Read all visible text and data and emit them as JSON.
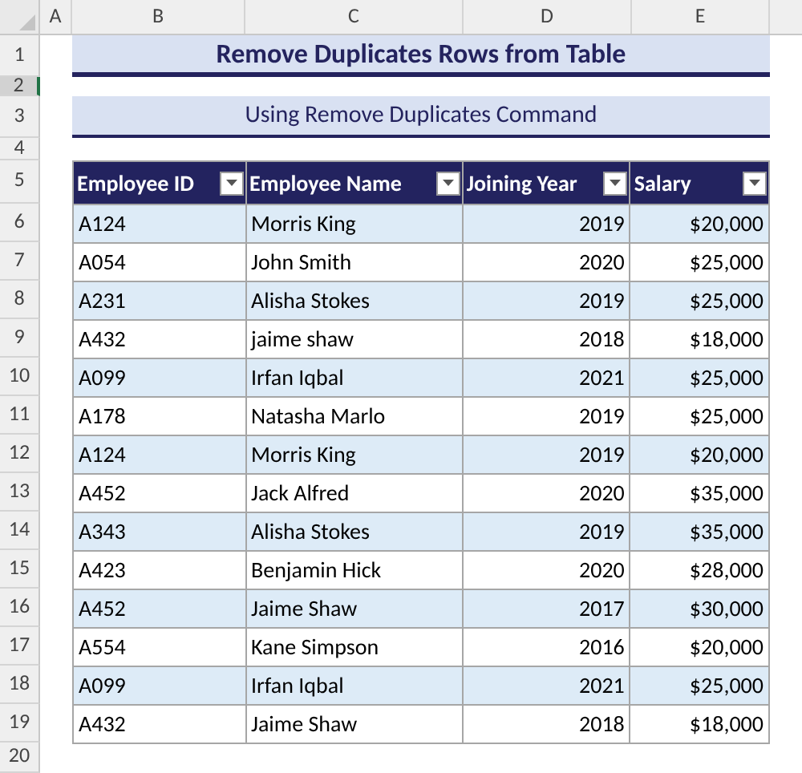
{
  "column_letters": [
    "A",
    "B",
    "C",
    "D",
    "E"
  ],
  "row_headers": [
    {
      "label": "1",
      "selected": false
    },
    {
      "label": "2",
      "selected": true
    },
    {
      "label": "3",
      "selected": false
    },
    {
      "label": "4",
      "selected": false
    },
    {
      "label": "5",
      "selected": false
    },
    {
      "label": "6",
      "selected": false
    },
    {
      "label": "7",
      "selected": false
    },
    {
      "label": "8",
      "selected": false
    },
    {
      "label": "9",
      "selected": false
    },
    {
      "label": "10",
      "selected": false
    },
    {
      "label": "11",
      "selected": false
    },
    {
      "label": "12",
      "selected": false
    },
    {
      "label": "13",
      "selected": false
    },
    {
      "label": "14",
      "selected": false
    },
    {
      "label": "15",
      "selected": false
    },
    {
      "label": "16",
      "selected": false
    },
    {
      "label": "17",
      "selected": false
    },
    {
      "label": "18",
      "selected": false
    },
    {
      "label": "19",
      "selected": false
    },
    {
      "label": "20",
      "selected": false
    }
  ],
  "title": "Remove Duplicates Rows from Table",
  "subtitle": "Using Remove Duplicates Command",
  "table": {
    "columns": [
      "Employee ID",
      "Employee Name",
      "Joining Year",
      "Salary"
    ],
    "rows": [
      [
        "A124",
        "Morris King",
        "2019",
        "$20,000"
      ],
      [
        "A054",
        "John Smith",
        "2020",
        "$25,000"
      ],
      [
        "A231",
        "Alisha Stokes",
        "2019",
        "$25,000"
      ],
      [
        "A432",
        "jaime shaw",
        "2018",
        "$18,000"
      ],
      [
        "A099",
        "Irfan Iqbal",
        "2021",
        "$25,000"
      ],
      [
        "A178",
        "Natasha Marlo",
        "2019",
        "$25,000"
      ],
      [
        "A124",
        "Morris King",
        "2019",
        "$20,000"
      ],
      [
        "A452",
        "Jack Alfred",
        "2020",
        "$35,000"
      ],
      [
        "A343",
        "Alisha Stokes",
        "2019",
        "$35,000"
      ],
      [
        "A423",
        "Benjamin Hick",
        "2020",
        "$28,000"
      ],
      [
        "A452",
        "Jaime Shaw",
        "2017",
        "$30,000"
      ],
      [
        "A554",
        "Kane Simpson",
        "2016",
        "$20,000"
      ],
      [
        "A099",
        "Irfan Iqbal",
        "2021",
        "$25,000"
      ],
      [
        "A432",
        "Jaime Shaw",
        "2018",
        "$18,000"
      ]
    ]
  }
}
